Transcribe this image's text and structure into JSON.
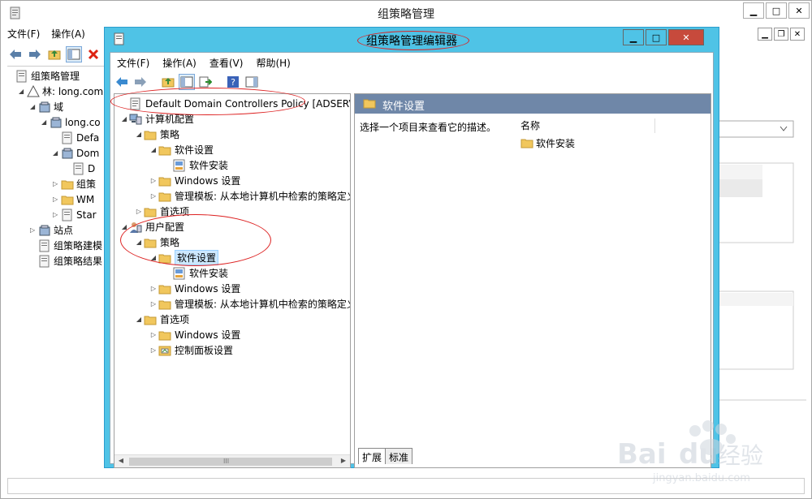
{
  "outer": {
    "title": "组策略管理",
    "menu": [
      "文件(F)",
      "操作(A)"
    ],
    "tree": [
      {
        "label": "组策略管理",
        "indent": 0,
        "arrow": ""
      },
      {
        "label": "林: long.com",
        "indent": 1,
        "arrow": "▲"
      },
      {
        "label": "域",
        "indent": 2,
        "arrow": "▲"
      },
      {
        "label": "long.co",
        "indent": 3,
        "arrow": "▲"
      },
      {
        "label": "Defa",
        "indent": 4,
        "arrow": ""
      },
      {
        "label": "Dom",
        "indent": 4,
        "arrow": "▲"
      },
      {
        "label": "D",
        "indent": 5,
        "arrow": ""
      },
      {
        "label": "组策",
        "indent": 4,
        "arrow": "▷"
      },
      {
        "label": "WM",
        "indent": 4,
        "arrow": "▷"
      },
      {
        "label": "Star",
        "indent": 4,
        "arrow": "▷"
      },
      {
        "label": "站点",
        "indent": 2,
        "arrow": "▷"
      },
      {
        "label": "组策略建模",
        "indent": 2,
        "arrow": ""
      },
      {
        "label": "组策略结果",
        "indent": 2,
        "arrow": ""
      }
    ]
  },
  "inner": {
    "title": "组策略管理编辑器",
    "menu": [
      "文件(F)",
      "操作(A)",
      "查看(V)",
      "帮助(H)"
    ],
    "tree": [
      {
        "label": "Default Domain Controllers Policy [ADSERVER.LC",
        "indent": 0,
        "arrow": "",
        "icon": "policy"
      },
      {
        "label": "计算机配置",
        "indent": 0,
        "arrow": "▲",
        "icon": "computer"
      },
      {
        "label": "策略",
        "indent": 1,
        "arrow": "▲",
        "icon": "folder"
      },
      {
        "label": "软件设置",
        "indent": 2,
        "arrow": "▲",
        "icon": "folder"
      },
      {
        "label": "软件安装",
        "indent": 3,
        "arrow": "",
        "icon": "software"
      },
      {
        "label": "Windows 设置",
        "indent": 2,
        "arrow": "▷",
        "icon": "folder"
      },
      {
        "label": "管理模板: 从本地计算机中检索的策略定义",
        "indent": 2,
        "arrow": "▷",
        "icon": "folder"
      },
      {
        "label": "首选项",
        "indent": 1,
        "arrow": "▷",
        "icon": "folder"
      },
      {
        "label": "用户配置",
        "indent": 0,
        "arrow": "▲",
        "icon": "user"
      },
      {
        "label": "策略",
        "indent": 1,
        "arrow": "▲",
        "icon": "folder"
      },
      {
        "label": "软件设置",
        "indent": 2,
        "arrow": "▲",
        "icon": "folder",
        "selected": true
      },
      {
        "label": "软件安装",
        "indent": 3,
        "arrow": "",
        "icon": "software"
      },
      {
        "label": "Windows 设置",
        "indent": 2,
        "arrow": "▷",
        "icon": "folder"
      },
      {
        "label": "管理模板: 从本地计算机中检索的策略定义",
        "indent": 2,
        "arrow": "▷",
        "icon": "folder"
      },
      {
        "label": "首选项",
        "indent": 1,
        "arrow": "▲",
        "icon": "folder"
      },
      {
        "label": "Windows 设置",
        "indent": 2,
        "arrow": "▷",
        "icon": "folder"
      },
      {
        "label": "控制面板设置",
        "indent": 2,
        "arrow": "▷",
        "icon": "control"
      }
    ],
    "right": {
      "header": "软件设置",
      "description": "选择一个项目来查看它的描述。",
      "column": "名称",
      "items": [
        "软件安装"
      ],
      "tabs": [
        "扩展",
        "标准"
      ]
    },
    "scroll_grip": "III"
  },
  "colors": {
    "inner_frame": "#4fc3e6",
    "right_header": "#6f87a8",
    "annotation": "#d22222",
    "selected": "#cce8ff"
  },
  "watermark": {
    "brand": "Bai",
    "brand2": "du",
    "cn": "经验",
    "url": "jingyan.baidu.com"
  }
}
